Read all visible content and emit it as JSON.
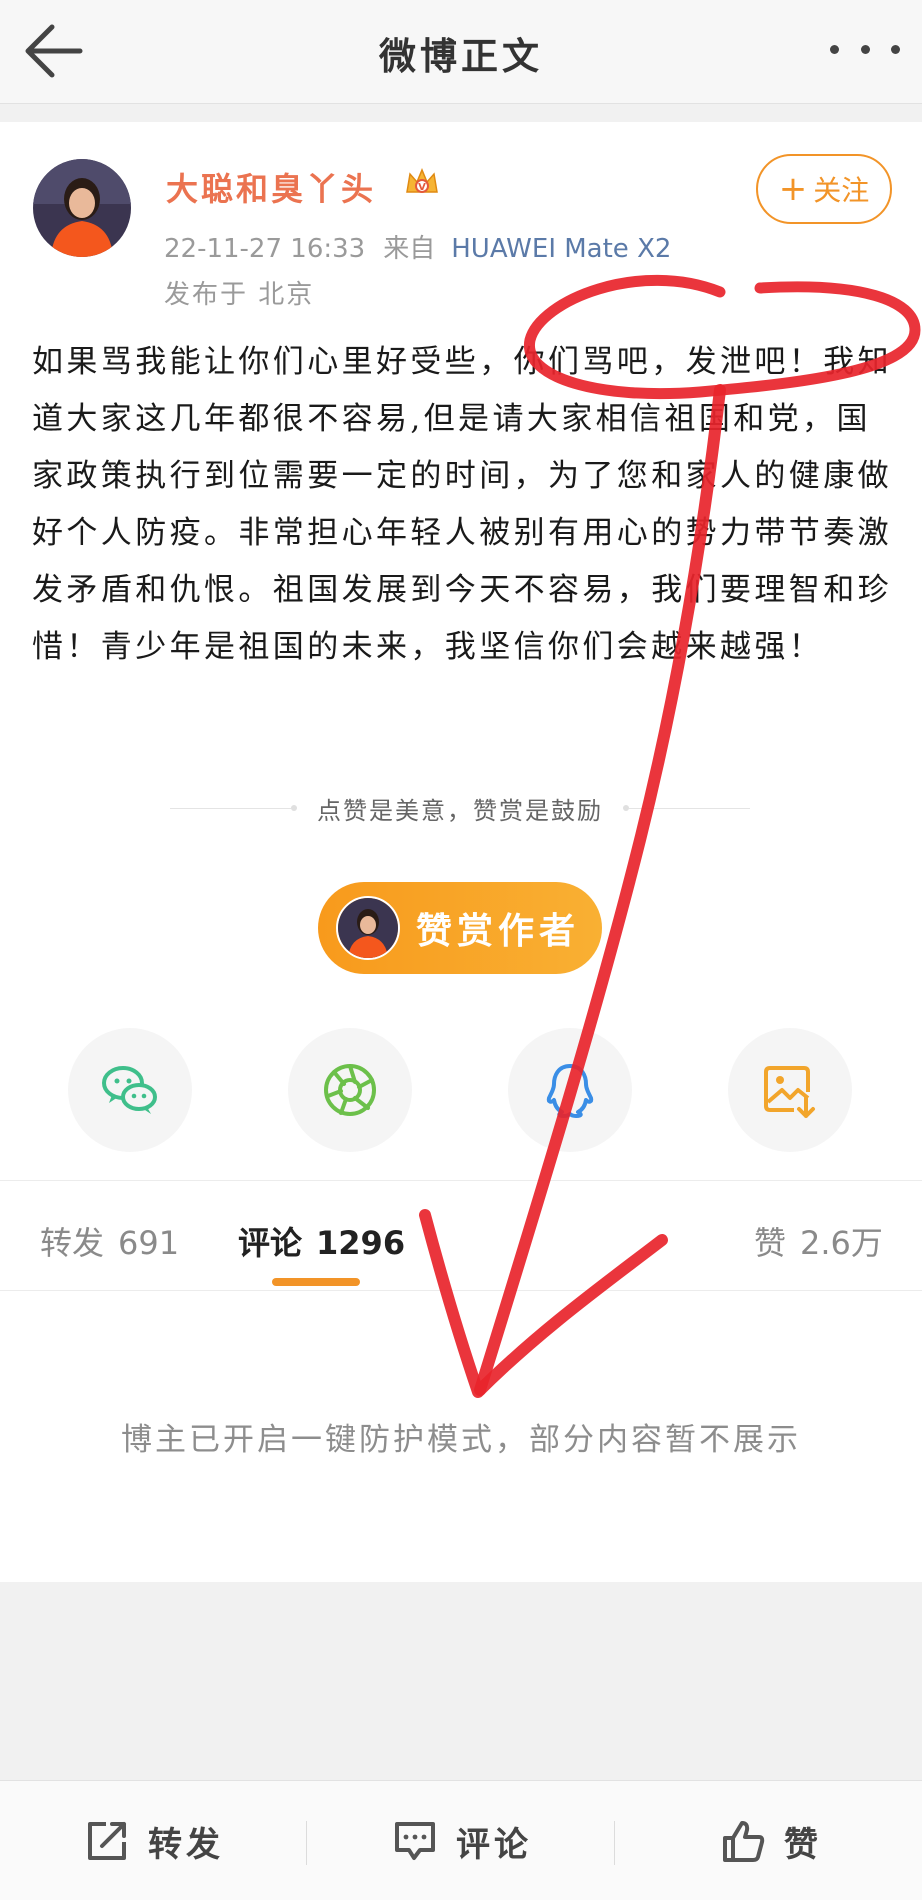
{
  "header": {
    "title": "微博正文",
    "back_icon": "back-arrow-icon",
    "more_icon": "more-dots-icon"
  },
  "post": {
    "author": "大聪和臭丫头",
    "badge_icon": "crown-vip-icon",
    "follow_label": "关注",
    "time": "22-11-27 16:33",
    "source_prefix": "来自",
    "device": "HUAWEI Mate X2",
    "location": "发布于 北京",
    "content": "如果骂我能让你们心里好受些，你们骂吧，发泄吧！我知道大家这几年都很不容易,但是请大家相信祖国和党，国家政策执行到位需要一定的时间，为了您和家人的健康做好个人防疫。非常担心年轻人被别有用心的势力带节奏激发矛盾和仇恨。祖国发展到今天不容易，我们要理智和珍惜！青少年是祖国的未来，我坚信你们会越来越强！"
  },
  "reward": {
    "caption": "点赞是美意，赞赏是鼓励",
    "button_label": "赞赏作者"
  },
  "share": {
    "items": [
      {
        "icon": "wechat-icon",
        "color": "#3fbf8b"
      },
      {
        "icon": "moments-icon",
        "color": "#6cc04a"
      },
      {
        "icon": "qq-icon",
        "color": "#3a8ee6"
      },
      {
        "icon": "save-image-icon",
        "color": "#f2a52b"
      }
    ]
  },
  "tabs": {
    "repost": {
      "label": "转发",
      "count": "691"
    },
    "comments": {
      "label": "评论",
      "count": "1296"
    },
    "likes": {
      "label": "赞",
      "count": "2.6万"
    }
  },
  "notice": "博主已开启一键防护模式，部分内容暂不展示",
  "bottom_bar": {
    "repost": "转发",
    "comment": "评论",
    "like": "赞"
  },
  "colors": {
    "accent": "#f29428",
    "author_name": "#eb7350",
    "annotation_red": "#e8242b"
  }
}
